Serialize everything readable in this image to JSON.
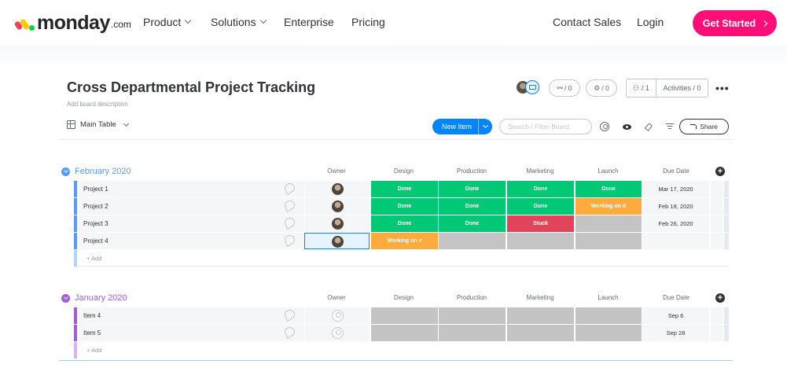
{
  "nav": {
    "logo_text": "monday",
    "logo_suffix": ".com",
    "items": [
      "Product",
      "Solutions",
      "Enterprise",
      "Pricing"
    ],
    "contact": "Contact Sales",
    "login": "Login",
    "cta": "Get Started"
  },
  "board": {
    "title": "Cross Departmental Project Tracking",
    "description": "Add board description",
    "header_counts": {
      "integrations": "/ 0",
      "automations": "/ 0",
      "members": "/ 1",
      "activities": "Activities / 0"
    }
  },
  "toolbar": {
    "view": "Main Table",
    "new_item": "New Item",
    "search_placeholder": "Search / Filter Board",
    "share": "Share"
  },
  "columns": [
    "Owner",
    "Design",
    "Production",
    "Marketing",
    "Launch",
    "Due Date"
  ],
  "colors": {
    "done": "#00c875",
    "working": "#fdab3d",
    "stuck": "#e2445c",
    "empty": "#c4c4c4",
    "group_feb": "#579bfc",
    "group_jan": "#a25ddc"
  },
  "groups": [
    {
      "title": "February 2020",
      "add_label": "+ Add",
      "rows": [
        {
          "name": "Project 1",
          "statuses": [
            "Done",
            "Done",
            "Done",
            "Done"
          ],
          "date": "Mar 17, 2020"
        },
        {
          "name": "Project 2",
          "statuses": [
            "Done",
            "Done",
            "Done",
            "Working on it"
          ],
          "date": "Feb 18, 2020"
        },
        {
          "name": "Project 3",
          "statuses": [
            "Done",
            "Done",
            "Stuck",
            ""
          ],
          "date": "Feb 26, 2020"
        },
        {
          "name": "Project 4",
          "statuses": [
            "Working on it",
            "",
            "",
            ""
          ],
          "date": ""
        }
      ]
    },
    {
      "title": "January 2020",
      "add_label": "+ Add",
      "rows": [
        {
          "name": "Item 4",
          "statuses": [
            "",
            "",
            "",
            ""
          ],
          "date": "Sep 6"
        },
        {
          "name": "Item 5",
          "statuses": [
            "",
            "",
            "",
            ""
          ],
          "date": "Sep 28"
        }
      ]
    }
  ]
}
